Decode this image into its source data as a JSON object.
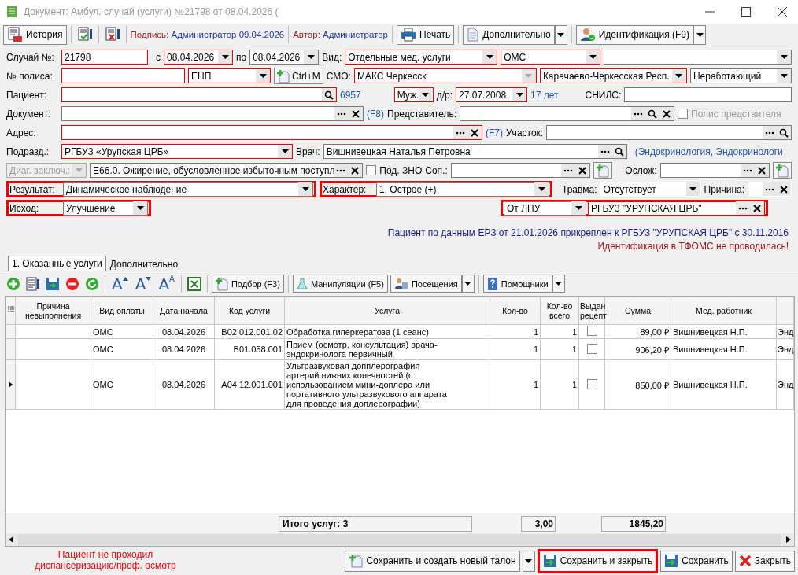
{
  "window": {
    "title": "Документ: Амбул. случай (услуги) №21798 от 08.04.2026 ("
  },
  "toolbar": [
    {
      "kind": "button",
      "text": "История",
      "menu": false
    },
    {
      "kind": "icon"
    },
    {
      "kind": "icon"
    },
    {
      "kind": "status",
      "label": "Подпись:",
      "value": "Администратор 09.04.2026"
    },
    {
      "kind": "status",
      "label": "Автор:",
      "value": "Администратор"
    },
    {
      "kind": "button",
      "text": "Печать",
      "menu": false
    },
    {
      "kind": "button",
      "text": "Дополнительно",
      "menu": true
    },
    {
      "kind": "button",
      "text": "Идентификация (F9)",
      "menu": true
    }
  ],
  "form": [
    [
      {
        "kind": "label",
        "text": "Случай №:"
      },
      {
        "kind": "field",
        "value": "21798",
        "required": true
      },
      {
        "kind": "label",
        "text": "с"
      },
      {
        "kind": "combo",
        "value": "08.04.2026",
        "required": true
      },
      {
        "kind": "label",
        "text": "по"
      },
      {
        "kind": "combo",
        "value": "08.04.2026",
        "required": false
      },
      {
        "kind": "label",
        "text": "Вид:"
      },
      {
        "kind": "combo",
        "value": "Отдельные мед. услуги",
        "required": true
      },
      {
        "kind": "combo",
        "value": "ОМС",
        "required": true
      },
      {
        "kind": "combo",
        "required": false
      }
    ],
    [
      {
        "kind": "label",
        "text": "№ полиса:"
      },
      {
        "kind": "field",
        "required": true
      },
      {
        "kind": "combo",
        "value": "ЕНП",
        "required": true
      },
      {
        "kind": "addbutton",
        "text": "Ctrl+M"
      },
      {
        "kind": "label",
        "text": "СМО:"
      },
      {
        "kind": "combo",
        "value": "МАКС Черкесск",
        "required": true,
        "locked": true
      },
      {
        "kind": "combo",
        "value": "Карачаево-Черкесская Респ.",
        "required": true
      },
      {
        "kind": "combo",
        "value": "Неработающий",
        "required": false
      }
    ],
    [
      {
        "kind": "label",
        "text": "Пациент:"
      },
      {
        "kind": "field",
        "required": true
      },
      {
        "kind": "hint",
        "text": "6957"
      },
      {
        "kind": "combo",
        "value": "Муж.",
        "required": true
      },
      {
        "kind": "label",
        "text": "д/р:"
      },
      {
        "kind": "combo",
        "value": "27.07.2008",
        "required": true
      },
      {
        "kind": "hint",
        "text": "17 лет"
      },
      {
        "kind": "label",
        "text": "СНИЛС:"
      },
      {
        "kind": "field",
        "required": false
      }
    ],
    [
      {
        "kind": "label",
        "text": "Документ:"
      },
      {
        "kind": "field",
        "required": false
      },
      {
        "kind": "hint",
        "text": "(F8)"
      },
      {
        "kind": "label",
        "text": "Представитель:"
      },
      {
        "kind": "field",
        "required": false
      },
      {
        "kind": "checkbox",
        "text": "Полис предствителя",
        "checked": false,
        "disabled": true
      }
    ],
    [
      {
        "kind": "label",
        "text": "Адрес:"
      },
      {
        "kind": "field",
        "required": true
      },
      {
        "kind": "hint",
        "text": "(F7)"
      },
      {
        "kind": "label",
        "text": "Участок:"
      },
      {
        "kind": "field",
        "required": false
      }
    ],
    [
      {
        "kind": "label",
        "text": "Подразд.:"
      },
      {
        "kind": "combo",
        "value": "РГБУЗ «Урупская ЦРБ»",
        "required": true
      },
      {
        "kind": "label",
        "text": "Врач:"
      },
      {
        "kind": "field",
        "value": "Вишнивецкая Наталья Петровна",
        "required": false
      },
      {
        "kind": "hint",
        "text": "(Эндокринология, Эндокринологи"
      }
    ],
    [
      {
        "kind": "combo",
        "value": "Диаг. заключ.:",
        "required": false,
        "disabled": true
      },
      {
        "kind": "field",
        "value": "E66.0. Ожирение, обусловленное избыточным поступл",
        "required": false
      },
      {
        "kind": "checkbox",
        "text": "Под. ЗНО",
        "checked": false,
        "disabled": false
      },
      {
        "kind": "label",
        "text": "Соп.:"
      },
      {
        "kind": "field",
        "required": false
      },
      {
        "kind": "addbutton"
      },
      {
        "kind": "label",
        "text": "Ослож:"
      },
      {
        "kind": "field",
        "required": false
      },
      {
        "kind": "addbutton"
      }
    ],
    [
      {
        "kind": "group",
        "alert": true,
        "items": [
          {
            "kind": "label",
            "text": "Результат:"
          },
          {
            "kind": "combo",
            "value": "Динамическое наблюдение",
            "required": false
          }
        ]
      },
      {
        "kind": "group",
        "alert": true,
        "items": [
          {
            "kind": "label",
            "text": "Характер:"
          },
          {
            "kind": "combo",
            "value": "1. Острое (+)",
            "required": false
          }
        ]
      },
      {
        "kind": "label",
        "text": "Травма:"
      },
      {
        "kind": "combo",
        "value": "Отсутствует",
        "flat": true
      },
      {
        "kind": "label",
        "text": "Причина:"
      },
      {
        "kind": "field",
        "flat": true
      }
    ],
    [
      {
        "kind": "group",
        "alert": true,
        "items": [
          {
            "kind": "label",
            "text": "Исход:"
          },
          {
            "kind": "combo",
            "value": "Улучшение",
            "required": false
          }
        ]
      },
      {
        "kind": "group",
        "alert": true,
        "items": [
          {
            "kind": "combo",
            "value": "От ЛПУ",
            "required": false
          },
          {
            "kind": "field",
            "value": "РГБУЗ \"УРУПСКАЯ ЦРБ\"",
            "required": true
          }
        ]
      }
    ]
  ],
  "notices": [
    {
      "kind": "info",
      "text": "Пациент по данным ЕРЗ от 21.01.2026 прикреплен к РГБУЗ \"УРУПСКАЯ ЦРБ\" с 30.11.2016"
    },
    {
      "kind": "warning",
      "text": "Идентификация в ТФОМС не проводилась!"
    }
  ],
  "tabs": [
    {
      "label": "1. Оказанные услуги",
      "selected": true
    },
    {
      "label": "Дополнительно",
      "selected": false
    }
  ],
  "grid_toolbar": [
    {
      "kind": "icon"
    },
    {
      "kind": "icon"
    },
    {
      "kind": "icon"
    },
    {
      "kind": "icon"
    },
    {
      "kind": "icon"
    },
    {
      "kind": "font",
      "text": "A"
    },
    {
      "kind": "font",
      "text": "A"
    },
    {
      "kind": "font",
      "text": "A",
      "sup": "A"
    },
    {
      "kind": "icon"
    },
    {
      "kind": "button",
      "text": "Подбор (F3)",
      "menu": false
    },
    {
      "kind": "button",
      "text": "Манипуляции (F5)",
      "menu": false
    },
    {
      "kind": "button",
      "text": "Посещения",
      "menu": true
    },
    {
      "kind": "button",
      "text": "Помощники",
      "menu": true
    }
  ],
  "table": {
    "columns": [
      "Причина невыполнения",
      "Вид оплаты",
      "Дата начала",
      "Код услуги",
      "Услуга",
      "Кол-во",
      "Кол-во всего",
      "Выдан рецепт",
      "Сумма",
      "Мед. работник"
    ],
    "rows": [
      {
        "selected": false,
        "payment": "ОМС",
        "date": "08.04.2026",
        "code": "B02.012.001.02",
        "service": "Обработка гиперкератоза (1 сеанс)",
        "qty": "1",
        "qty_total": "1",
        "prescription": false,
        "sum": "89,00 ₽",
        "worker": "Вишнивецкая Н.П.",
        "column_12": "Энд"
      },
      {
        "selected": false,
        "payment": "ОМС",
        "date": "08.04.2026",
        "code": "B01.058.001",
        "service": "Прием (осмотр, консультация) врача-эндокринолога первичный",
        "qty": "1",
        "qty_total": "1",
        "prescription": false,
        "sum": "906,20 ₽",
        "worker": "Вишнивецкая Н.П.",
        "column_12": "Энд"
      },
      {
        "selected": true,
        "payment": "ОМС",
        "date": "08.04.2026",
        "code": "A04.12.001.001",
        "service": "Ультразвуковая допплерография артерий нижних конечностей (с использованием мини-доплера или портативного ультразвукового аппарата для проведения доплерографии)",
        "qty": "1",
        "qty_total": "1",
        "prescription": false,
        "sum": "850,00 ₽",
        "worker": "Вишнивецкая Н.П.",
        "column_12": "Энд"
      }
    ],
    "totals": {
      "label": "Итого услуг: 3",
      "qty": "3,00",
      "sum": "1845,20"
    }
  },
  "footer": {
    "warning": "Пациент не проходил диспансеризацию/проф. осмотр",
    "buttons": [
      {
        "text": "Сохранить и создать новый талон",
        "menu": true,
        "highlighted": false
      },
      {
        "text": "Сохранить и закрыть",
        "highlighted": true
      },
      {
        "text": "Сохранить",
        "highlighted": false
      },
      {
        "text": "Закрыть",
        "highlighted": false
      }
    ]
  }
}
